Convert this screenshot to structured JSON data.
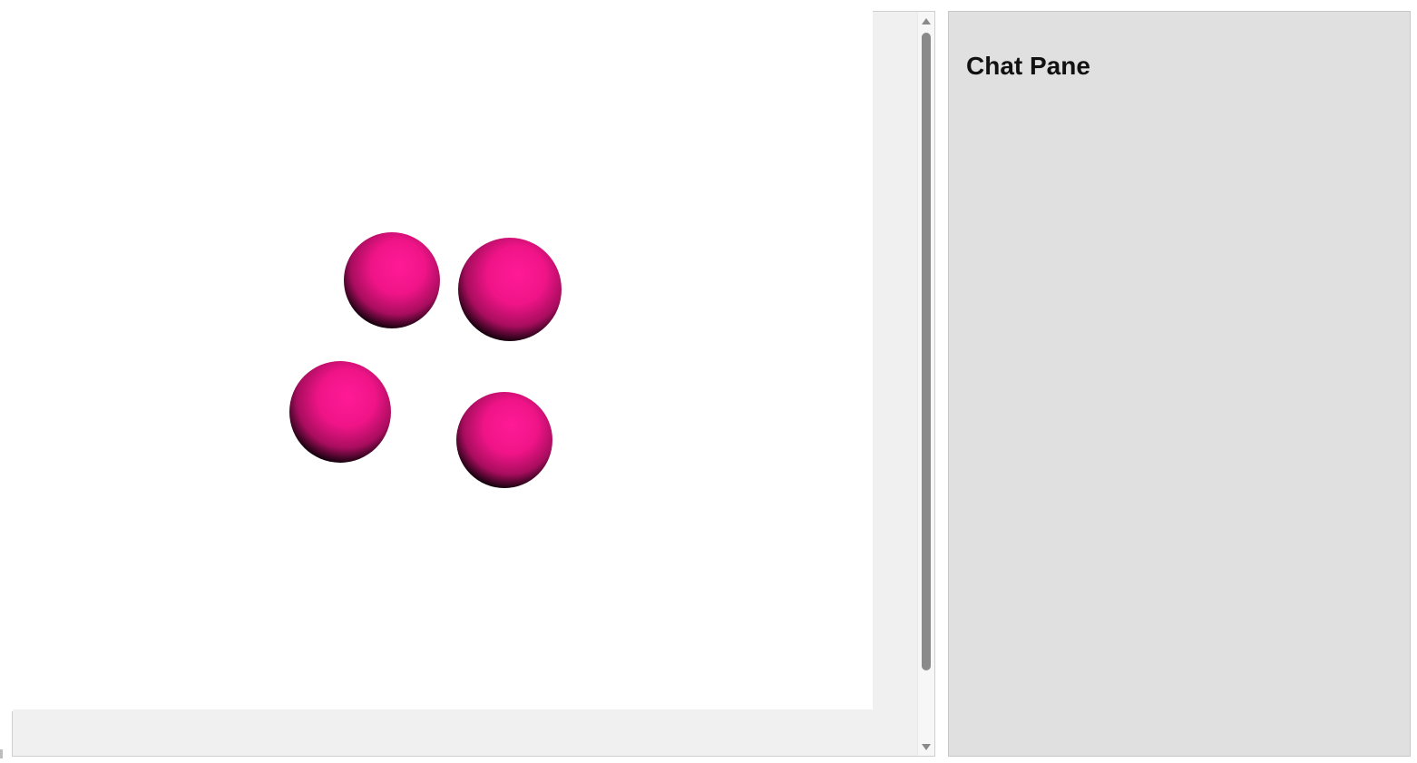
{
  "chat_pane": {
    "title": "Chat Pane"
  },
  "scene": {
    "sphere_color": "#ff1493",
    "sphere_count": 4
  },
  "icons": {
    "scroll_up": "triangle-up-icon",
    "scroll_down": "triangle-down-icon"
  }
}
